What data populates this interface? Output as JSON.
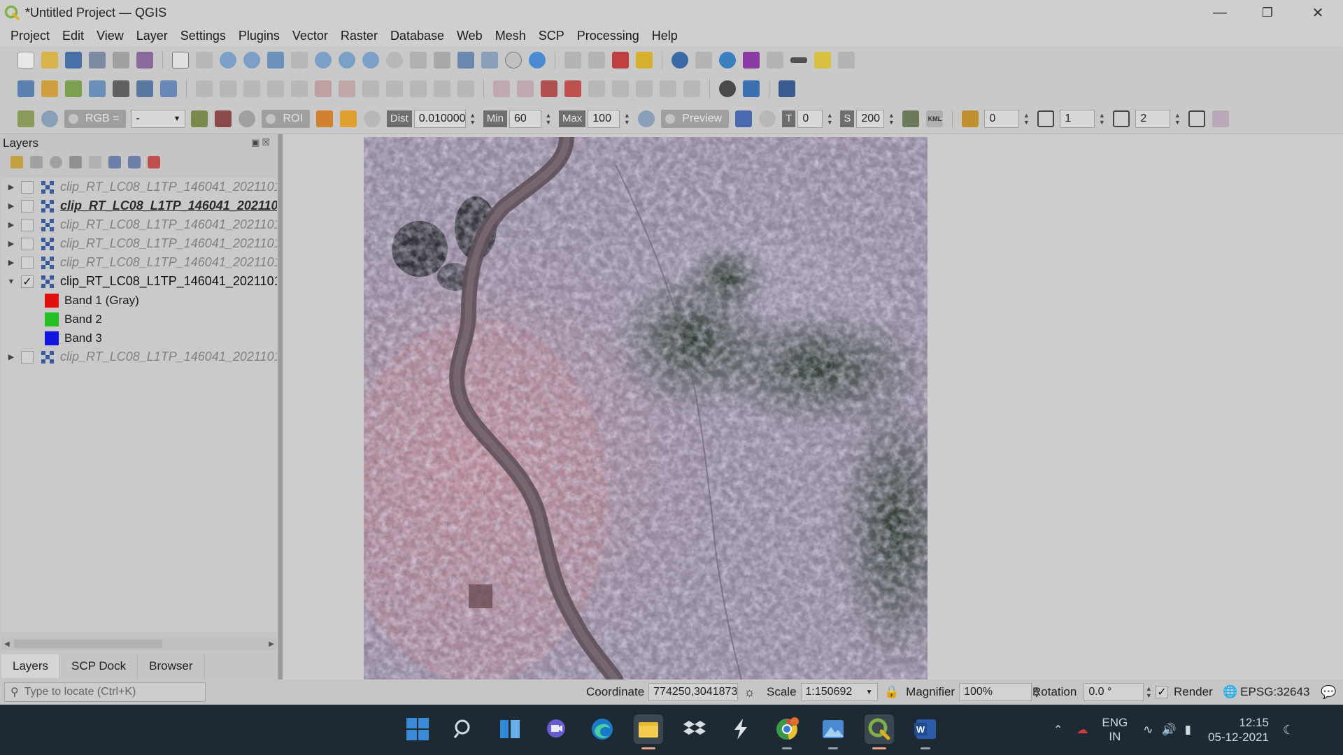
{
  "window": {
    "title": "*Untitled Project — QGIS"
  },
  "menu": [
    "Project",
    "Edit",
    "View",
    "Layer",
    "Settings",
    "Plugins",
    "Vector",
    "Raster",
    "Database",
    "Web",
    "Mesh",
    "SCP",
    "Processing",
    "Help"
  ],
  "scp_toolbar": {
    "rgb_label": "RGB =",
    "rgb_value": "-",
    "roi_label": "ROI",
    "dist_label": "Dist",
    "dist_value": "0.010000",
    "min_label": "Min",
    "min_value": "60",
    "max_label": "Max",
    "max_value": "100",
    "preview_label": "Preview",
    "t_label": "T",
    "t_value": "0",
    "s_label": "S",
    "s_value": "200",
    "kml_label": "KML",
    "band_a_value": "0",
    "band_b_value": "1",
    "band_c_value": "2"
  },
  "layers_panel": {
    "title": "Layers",
    "layers": [
      {
        "name": "clip_RT_LC08_L1TP_146041_2021101(",
        "checked": false,
        "style": "dim"
      },
      {
        "name": "clip_RT_LC08_L1TP_146041_2021101(",
        "checked": false,
        "style": "current"
      },
      {
        "name": "clip_RT_LC08_L1TP_146041_2021101(",
        "checked": false,
        "style": "dim"
      },
      {
        "name": "clip_RT_LC08_L1TP_146041_2021101(",
        "checked": false,
        "style": "dim"
      },
      {
        "name": "clip_RT_LC08_L1TP_146041_2021101(",
        "checked": false,
        "style": "dim"
      },
      {
        "name": "clip_RT_LC08_L1TP_146041_2021101(",
        "checked": true,
        "style": "on",
        "expanded": true
      },
      {
        "name": "clip_RT_LC08_L1TP_146041_2021101(",
        "checked": false,
        "style": "dim"
      }
    ],
    "bands": [
      {
        "label": "Band 1 (Gray)",
        "color": "#e01010"
      },
      {
        "label": "Band 2",
        "color": "#22c022"
      },
      {
        "label": "Band 3",
        "color": "#1515e0"
      }
    ],
    "tabs": [
      "Layers",
      "SCP Dock",
      "Browser"
    ],
    "active_tab": "Layers"
  },
  "status": {
    "locate_placeholder": "Type to locate (Ctrl+K)",
    "coordinate_label": "Coordinate",
    "coordinate_value": "774250,3041873",
    "scale_label": "Scale",
    "scale_value": "1:150692",
    "magnifier_label": "Magnifier",
    "magnifier_value": "100%",
    "rotation_label": "Rotation",
    "rotation_value": "0.0 °",
    "render_label": "Render",
    "crs": "EPSG:32643"
  },
  "tray": {
    "lang1": "ENG",
    "lang2": "IN",
    "time": "12:15",
    "date": "05-12-2021"
  },
  "colors": {
    "chrome": "#cfcfcf",
    "taskbar": "#1e2a33",
    "qgis_green": "#7fb04a"
  }
}
